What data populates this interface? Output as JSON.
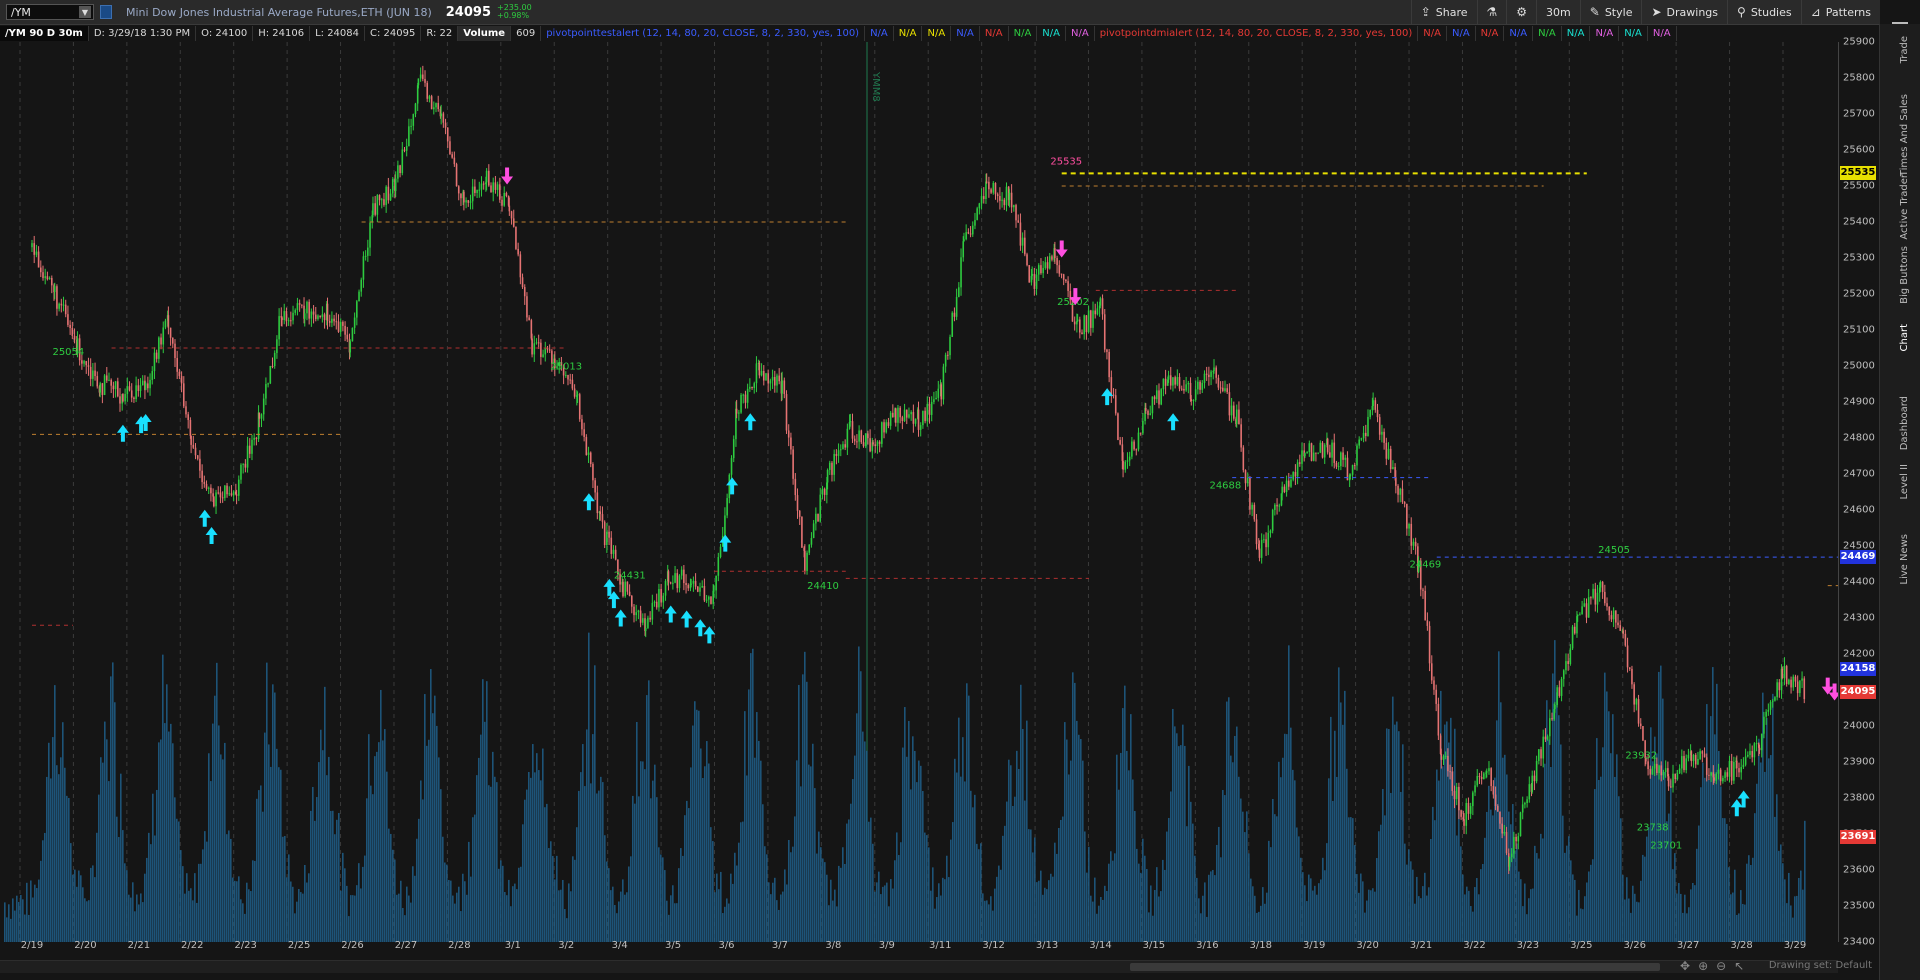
{
  "header": {
    "symbol": "/YM",
    "description": "Mini Dow Jones Industrial Average Futures,ETH (JUN 18)",
    "last_price": "24095",
    "change": "+235.00",
    "change_pct": "+0.98%",
    "tools": [
      {
        "icon": "share-icon",
        "label": "Share"
      },
      {
        "icon": "flask-icon",
        "label": ""
      },
      {
        "icon": "gear-icon",
        "label": ""
      },
      {
        "icon": "",
        "label": "30m"
      },
      {
        "icon": "style-icon",
        "label": "Style"
      },
      {
        "icon": "cursor-icon",
        "label": "Drawings"
      },
      {
        "icon": "studies-icon",
        "label": "Studies"
      },
      {
        "icon": "patterns-icon",
        "label": "Patterns"
      }
    ]
  },
  "infobar": {
    "title": "/YM 90 D 30m",
    "date": "D: 3/29/18 1:30 PM",
    "open": "O: 24100",
    "high": "H: 24106",
    "low": "L: 24084",
    "close": "C: 24095",
    "range": "R: 22",
    "volume_label": "Volume",
    "volume_value": "609",
    "study1": "pivotpointtestalert (12, 14, 80, 20, CLOSE, 8, 2, 330, yes, 100)",
    "study1_flags": [
      "N/A",
      "N/A",
      "N/A",
      "N/A",
      "N/A",
      "N/A"
    ],
    "study2": "pivotpointdmialert (12, 14, 80, 20, CLOSE, 8, 2, 330, yes, 100)",
    "study2_flags": [
      "N/A",
      "N/A",
      "N/A",
      "N/A",
      "N/A",
      "N/A",
      "N/A",
      "N/A",
      "N/A",
      "N/A"
    ]
  },
  "side_tabs": [
    "Trade",
    "Times And Sales",
    "Active Trader",
    "Big Buttons",
    "Chart",
    "Dashboard",
    "Level II",
    "Live News"
  ],
  "active_side_tab": "Chart",
  "status": "Drawing set: Default",
  "colors": {
    "up": "#2ecc40",
    "down": "#e57373",
    "volume": "#1f5f8a",
    "arrow_up": "#19e0ff",
    "arrow_down": "#ff4fe0",
    "bg": "#151515"
  },
  "chart_data": {
    "type": "candlestick",
    "ylim": [
      23400,
      25900
    ],
    "y_ticks": [
      25900,
      25800,
      25700,
      25600,
      25500,
      25400,
      25300,
      25200,
      25100,
      25000,
      24900,
      24800,
      24700,
      24600,
      24500,
      24400,
      24300,
      24200,
      24100,
      24000,
      23900,
      23800,
      23700,
      23600,
      23500,
      23400
    ],
    "x_ticks": [
      "2/19",
      "2/20",
      "2/21",
      "2/22",
      "2/23",
      "2/25",
      "2/26",
      "2/27",
      "2/28",
      "3/1",
      "3/2",
      "3/4",
      "3/5",
      "3/6",
      "3/7",
      "3/8",
      "3/9",
      "3/11",
      "3/12",
      "3/13",
      "3/14",
      "3/15",
      "3/16",
      "3/18",
      "3/19",
      "3/20",
      "3/21",
      "3/22",
      "3/23",
      "3/25",
      "3/26",
      "3/27",
      "3/28",
      "3/29"
    ],
    "contract_marker": "YMM8",
    "price_path": [
      [
        0,
        25330
      ],
      [
        1,
        25200
      ],
      [
        2,
        25050
      ],
      [
        3,
        24950
      ],
      [
        4,
        24920
      ],
      [
        5,
        24950
      ],
      [
        6,
        25130
      ],
      [
        7,
        24780
      ],
      [
        8,
        24620
      ],
      [
        9,
        24660
      ],
      [
        10,
        24850
      ],
      [
        11,
        25150
      ],
      [
        12,
        25150
      ],
      [
        13,
        25150
      ],
      [
        14,
        25060
      ],
      [
        15,
        25440
      ],
      [
        16,
        25500
      ],
      [
        17,
        25790
      ],
      [
        18,
        25690
      ],
      [
        19,
        25450
      ],
      [
        20,
        25520
      ],
      [
        21,
        25450
      ],
      [
        22,
        25060
      ],
      [
        23,
        25020
      ],
      [
        24,
        24900
      ],
      [
        25,
        24560
      ],
      [
        26,
        24390
      ],
      [
        27,
        24270
      ],
      [
        28,
        24420
      ],
      [
        29,
        24400
      ],
      [
        30,
        24350
      ],
      [
        31,
        24880
      ],
      [
        32,
        25000
      ],
      [
        33,
        24940
      ],
      [
        34,
        24450
      ],
      [
        35,
        24700
      ],
      [
        36,
        24820
      ],
      [
        37,
        24780
      ],
      [
        38,
        24870
      ],
      [
        39,
        24850
      ],
      [
        40,
        24930
      ],
      [
        41,
        25330
      ],
      [
        42,
        25490
      ],
      [
        43,
        25470
      ],
      [
        44,
        25230
      ],
      [
        45,
        25320
      ],
      [
        46,
        25100
      ],
      [
        47,
        25160
      ],
      [
        48,
        24700
      ],
      [
        49,
        24860
      ],
      [
        50,
        24960
      ],
      [
        51,
        24920
      ],
      [
        52,
        24980
      ],
      [
        53,
        24850
      ],
      [
        54,
        24470
      ],
      [
        55,
        24650
      ],
      [
        56,
        24760
      ],
      [
        57,
        24780
      ],
      [
        58,
        24700
      ],
      [
        59,
        24880
      ],
      [
        60,
        24690
      ],
      [
        61,
        24450
      ],
      [
        62,
        23930
      ],
      [
        63,
        23750
      ],
      [
        64,
        23900
      ],
      [
        65,
        23620
      ],
      [
        66,
        23850
      ],
      [
        67,
        24060
      ],
      [
        68,
        24300
      ],
      [
        69,
        24380
      ],
      [
        70,
        24250
      ],
      [
        71,
        23900
      ],
      [
        72,
        23850
      ],
      [
        73,
        23920
      ],
      [
        74,
        23870
      ],
      [
        75,
        23880
      ],
      [
        76,
        23960
      ],
      [
        77,
        24150
      ],
      [
        78,
        24095
      ]
    ],
    "annotations": [
      {
        "text": "25054",
        "kind": "low",
        "x": 1.6,
        "y": 25030
      },
      {
        "text": "25013",
        "kind": "low",
        "x": 23.5,
        "y": 24990
      },
      {
        "text": "24431",
        "kind": "low",
        "x": 26.3,
        "y": 24410
      },
      {
        "text": "24410",
        "kind": "low",
        "x": 34.8,
        "y": 24380
      },
      {
        "text": "25202",
        "kind": "low",
        "x": 45.8,
        "y": 25170
      },
      {
        "text": "24688",
        "kind": "low",
        "x": 52.5,
        "y": 24660
      },
      {
        "text": "24469",
        "kind": "low",
        "x": 61.3,
        "y": 24440
      },
      {
        "text": "24505",
        "kind": "low",
        "x": 69.6,
        "y": 24480
      },
      {
        "text": "23932",
        "kind": "low",
        "x": 70.8,
        "y": 23910
      },
      {
        "text": "23738",
        "kind": "low",
        "x": 71.3,
        "y": 23710
      },
      {
        "text": "23701",
        "kind": "low",
        "x": 71.9,
        "y": 23660
      },
      {
        "text": "23691",
        "kind": "low",
        "x": 80.3,
        "y": 23660
      },
      {
        "text": "25535",
        "kind": "high",
        "x": 45.5,
        "y": 25560
      }
    ],
    "levels": [
      {
        "y": 25535,
        "x1": 45.3,
        "x2": 68.4,
        "color": "#e8e000",
        "style": "dash-heavy"
      },
      {
        "y": 25500,
        "x1": 45.3,
        "x2": 66.5,
        "color": "#c08030",
        "style": "dash"
      },
      {
        "y": 25400,
        "x1": 14.5,
        "x2": 35.8,
        "color": "#c08030",
        "style": "dash"
      },
      {
        "y": 25050,
        "x1": 3.5,
        "x2": 23.5,
        "color": "#b03030",
        "style": "dash"
      },
      {
        "y": 24810,
        "x1": 0,
        "x2": 13.6,
        "color": "#c08030",
        "style": "dash"
      },
      {
        "y": 25210,
        "x1": 46.8,
        "x2": 53,
        "color": "#b03030",
        "style": "dash"
      },
      {
        "y": 24690,
        "x1": 52.8,
        "x2": 61.5,
        "color": "#3b5cff",
        "style": "dash"
      },
      {
        "y": 24469,
        "x1": 61.8,
        "x2": 84.5,
        "color": "#3b5cff",
        "style": "dash"
      },
      {
        "y": 24430,
        "x1": 30,
        "x2": 35.8,
        "color": "#b03030",
        "style": "dash"
      },
      {
        "y": 24410,
        "x1": 35.8,
        "x2": 46.5,
        "color": "#b03030",
        "style": "dash"
      },
      {
        "y": 24390,
        "x1": 79,
        "x2": 85.5,
        "color": "#c08030",
        "style": "dash"
      },
      {
        "y": 23691,
        "x1": 80,
        "x2": 86.5,
        "color": "#b03030",
        "style": "dash"
      },
      {
        "y": 24280,
        "x1": 0,
        "x2": 1.8,
        "color": "#b03030",
        "style": "dash"
      }
    ],
    "arrows_up": [
      4,
      4.8,
      5,
      7.6,
      7.9,
      24.5,
      25.4,
      25.9,
      25.6,
      28.1,
      28.8,
      29.4,
      29.8,
      30.5,
      30.8,
      31.6,
      47.3,
      50.2,
      75,
      75.3
    ],
    "arrows_down": [
      20.9,
      45.3,
      45.9,
      79.0,
      79.3,
      80.3,
      86.3
    ],
    "y_tags": [
      {
        "value": "25535",
        "bg": "#e8e000",
        "fg": "#000"
      },
      {
        "value": "24469",
        "bg": "#2233dd",
        "fg": "#fff"
      },
      {
        "value": "24158",
        "bg": "#2233dd",
        "fg": "#fff"
      },
      {
        "value": "24095",
        "bg": "#e53935",
        "fg": "#fff"
      },
      {
        "value": "23691",
        "bg": "#e53935",
        "fg": "#fff"
      }
    ]
  }
}
